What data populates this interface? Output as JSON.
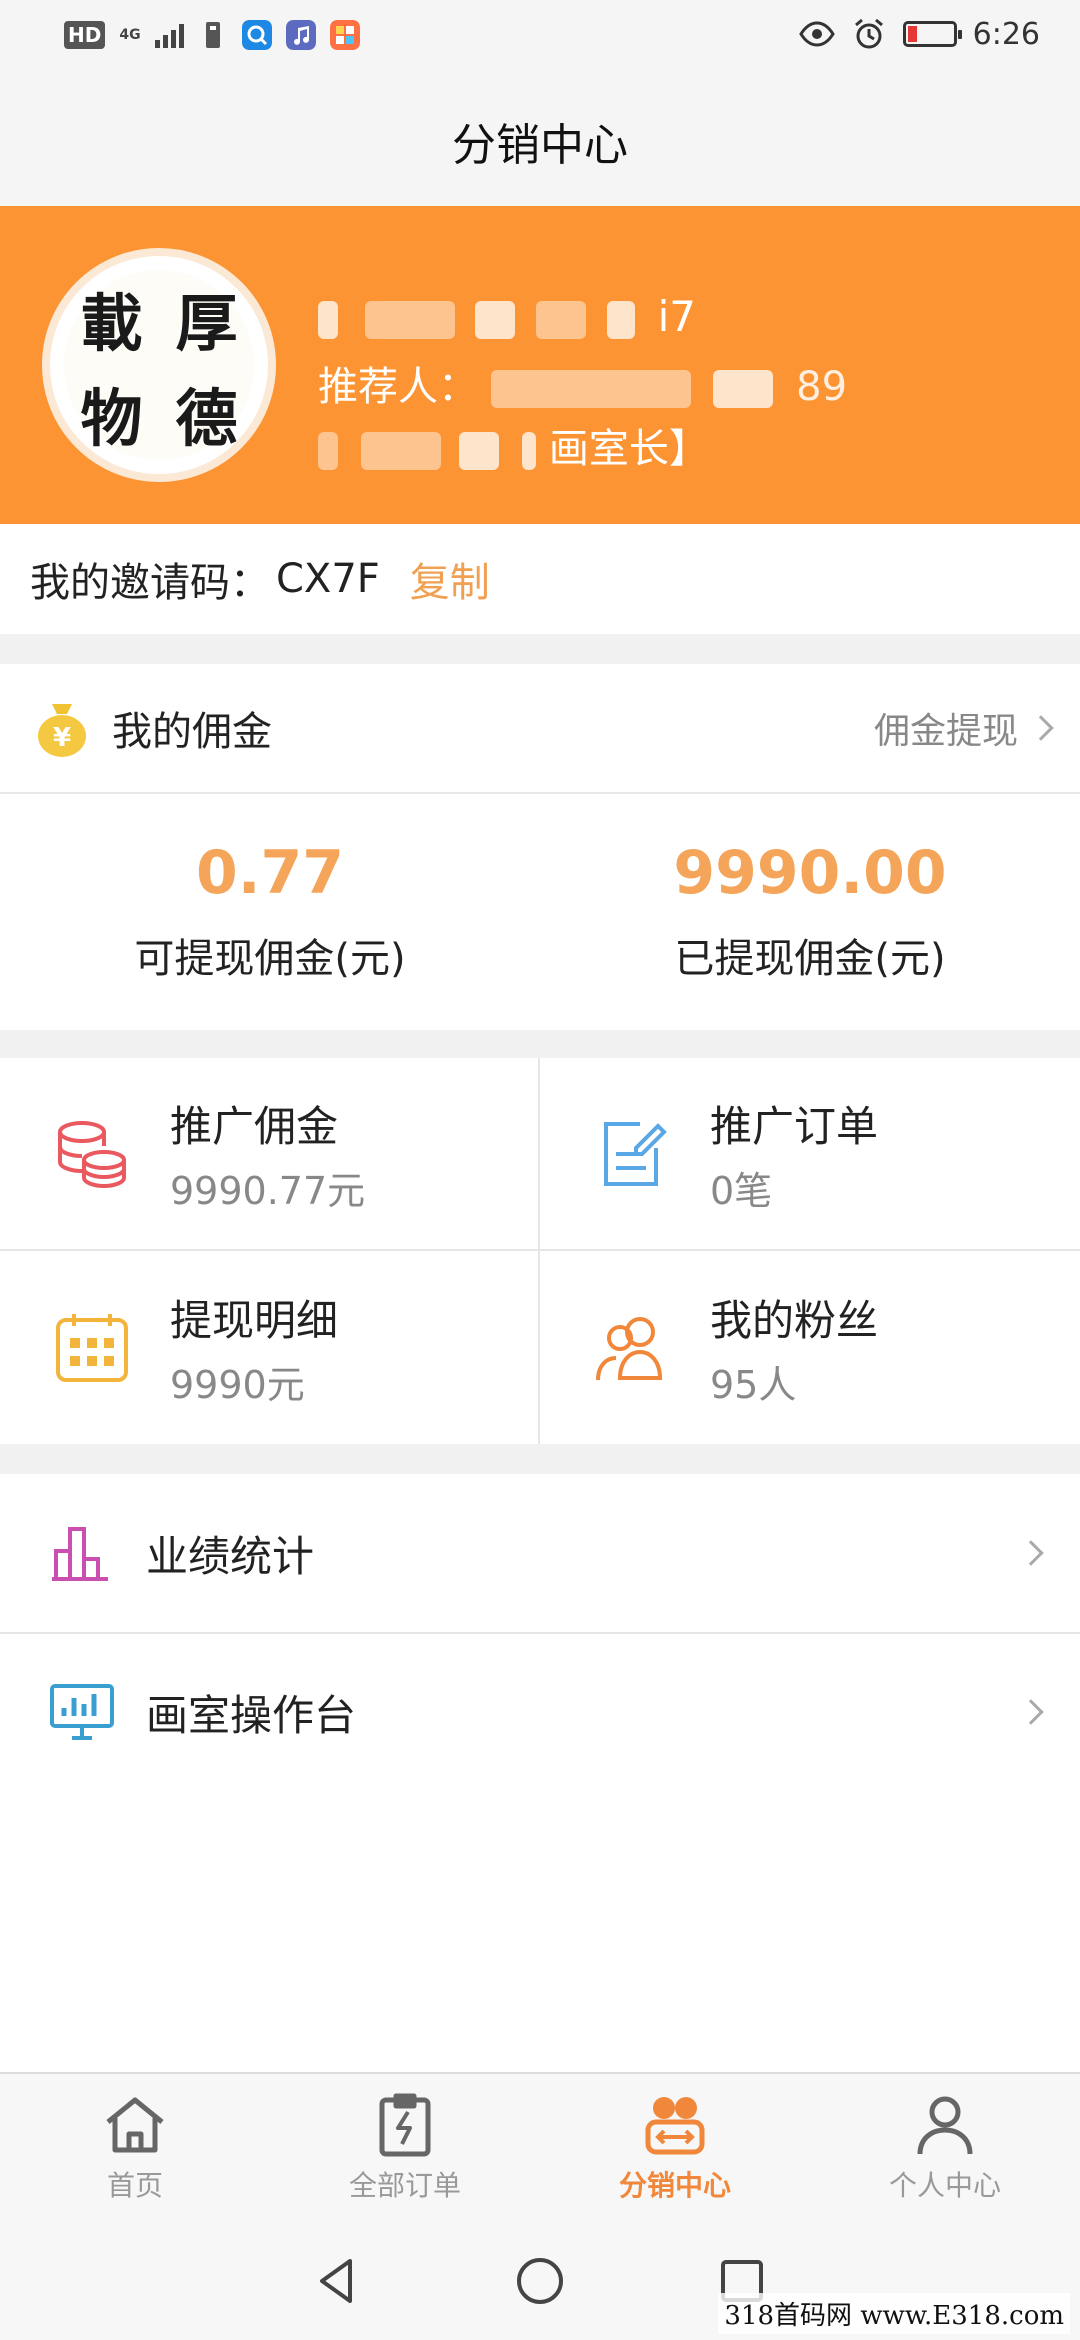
{
  "status_bar": {
    "hd": "HD",
    "network": "4G",
    "time": "6:26"
  },
  "title": "分销中心",
  "profile": {
    "avatar_text": [
      "載",
      "厚",
      "物",
      "德"
    ],
    "name_suffix": "i7",
    "referrer_label": "推荐人：",
    "referrer_suffix": "89",
    "role": "画室长】"
  },
  "invite": {
    "label": "我的邀请码：",
    "code": "CX7F",
    "copy_label": "复制"
  },
  "commission": {
    "title": "我的佣金",
    "withdraw_link": "佣金提现",
    "available_value": "0.77",
    "available_label": "可提现佣金(元)",
    "withdrawn_value": "9990.00",
    "withdrawn_label": "已提现佣金(元)"
  },
  "grid": [
    {
      "title": "推广佣金",
      "value": "9990.77元",
      "icon": "coins-icon",
      "color": "#e9595f"
    },
    {
      "title": "推广订单",
      "value": "0笔",
      "icon": "order-edit-icon",
      "color": "#5aa7e6"
    },
    {
      "title": "提现明细",
      "value": "9990元",
      "icon": "calendar-icon",
      "color": "#f2b43b"
    },
    {
      "title": "我的粉丝",
      "value": "95人",
      "icon": "fans-icon",
      "color": "#f0873a"
    }
  ],
  "menu": [
    {
      "label": "业绩统计",
      "icon": "bar-chart-icon",
      "color": "#c94fb0"
    },
    {
      "label": "画室操作台",
      "icon": "monitor-icon",
      "color": "#3a9fd0"
    }
  ],
  "tabs": [
    {
      "label": "首页",
      "icon": "home-icon"
    },
    {
      "label": "全部订单",
      "icon": "orders-icon"
    },
    {
      "label": "分销中心",
      "icon": "distribution-icon",
      "active": true
    },
    {
      "label": "个人中心",
      "icon": "user-icon"
    }
  ],
  "watermark": "318首码网 www.E318.com",
  "colors": {
    "accent": "#fc9433",
    "value_orange": "#f5a55a",
    "tab_active": "#f0873a"
  }
}
